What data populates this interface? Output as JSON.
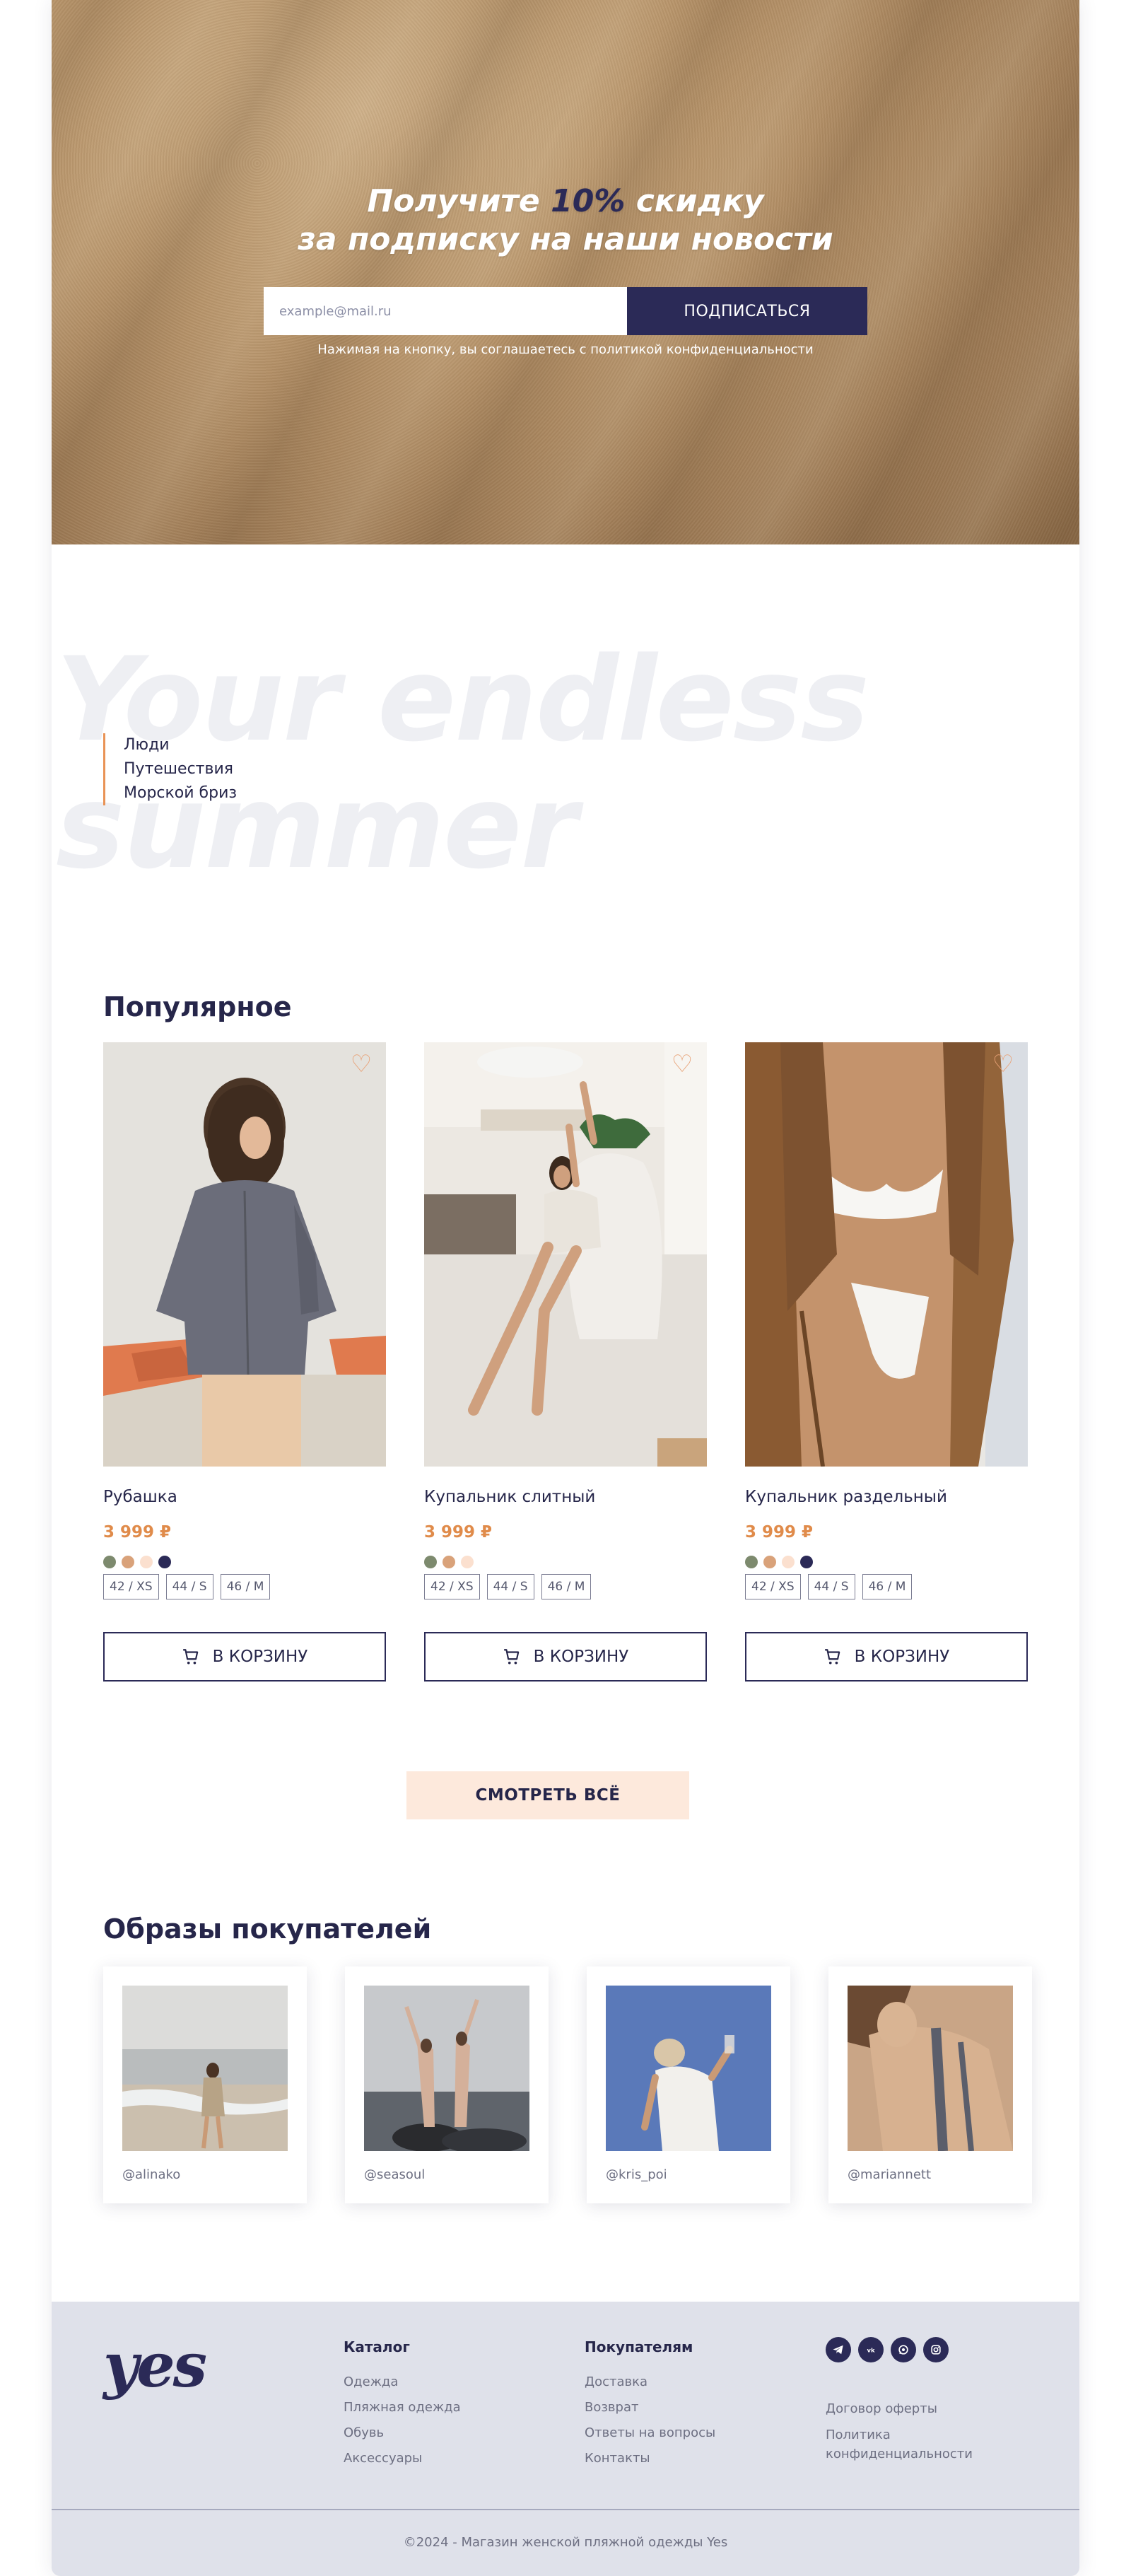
{
  "subscribe": {
    "title_before": "Получите ",
    "title_accent": "10%",
    "title_after": " скидку",
    "title_line2": "за подписку на наши новости",
    "placeholder": "example@mail.ru",
    "button": "ПОДПИСАТЬСЯ",
    "note": "Нажимая на кнопку, вы соглашаетесь с политикой конфиденциальности"
  },
  "tagline": {
    "line1": "Your endless",
    "line2": "summer",
    "items": [
      "Люди",
      "Путешествия",
      "Морской бриз"
    ]
  },
  "popular": {
    "title": "Популярное",
    "cart_label": "В КОРЗИНУ",
    "view_all": "СМОТРЕТЬ ВСЁ",
    "products": [
      {
        "name": "Рубашка",
        "price": "3 999 ₽",
        "colors": [
          "#7d8a6e",
          "#d9a27a",
          "#fbe0cf",
          "#2b2a57"
        ],
        "sizes": [
          "42 / XS",
          "44 / S",
          "46 / M"
        ]
      },
      {
        "name": "Купальник слитный",
        "price": "3 999 ₽",
        "colors": [
          "#7d8a6e",
          "#d9a27a",
          "#fbe0cf"
        ],
        "sizes": [
          "42 / XS",
          "44 / S",
          "46 / M"
        ]
      },
      {
        "name": "Купальник раздельный",
        "price": "3 999 ₽",
        "colors": [
          "#7d8a6e",
          "#d9a27a",
          "#fbe0cf",
          "#2b2a57"
        ],
        "sizes": [
          "42 / XS",
          "44 / S",
          "46 / M"
        ]
      }
    ]
  },
  "looks": {
    "title": "Образы покупателей",
    "handles": [
      "@alinako",
      "@seasoul",
      "@kris_poi",
      "@mariannett"
    ]
  },
  "footer": {
    "logo": "yes",
    "catalog": {
      "title": "Каталог",
      "links": [
        "Одежда",
        "Пляжная одежда",
        "Обувь",
        "Аксессуары"
      ]
    },
    "customers": {
      "title": "Покупателям",
      "links": [
        "Доставка",
        "Возврат",
        "Ответы на вопросы",
        "Контакты"
      ]
    },
    "socials": [
      "telegram-icon",
      "vk-icon",
      "whatsapp-icon",
      "instagram-icon"
    ],
    "legal": [
      "Договор оферты",
      "Политика",
      "конфиденциальности"
    ],
    "copyright": "©2024 - Магазин женской пляжной одежды Yes"
  },
  "colors": {
    "brand": "#2b2a57",
    "accent": "#e08b4a",
    "soft": "#fde9dc",
    "footer_bg": "#dfe1ea"
  }
}
